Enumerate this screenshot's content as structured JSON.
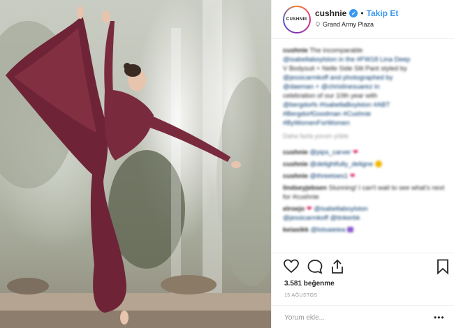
{
  "post": {
    "image_alt": "Dancer in burgundy satin dress posing in front of fountain"
  },
  "header": {
    "avatar_text": "CUSHNIE",
    "username": "cushnie",
    "separator": "•",
    "follow_label": "Takip Et",
    "location": "Grand Army Plaza"
  },
  "caption": {
    "user": "cushnie",
    "lines": [
      "The incomparable",
      "@isabellaboylston in the #FW18 Lina Deep",
      "V Bodysuit + Nelle Side Slit Pant styled by",
      "@jessicarmkoff and photographed by",
      "@daeman + @christinesuarez in",
      "celebration of our 10th year with",
      "@bergdorfs #IsabellaBoylston #ABT",
      "#BergdorfGoodman #Cushnie",
      "#ByWomenForWomen"
    ]
  },
  "view_replies": "Daha fazla yorum yükle",
  "comments": [
    {
      "user": "cushnie",
      "text": "@pips_carver",
      "emoji": "heart"
    },
    {
      "user": "cushnie",
      "text": "@delightfully_deligne",
      "emoji": "face"
    },
    {
      "user": "cushnie",
      "text": "@threetoes1",
      "emoji": "heart"
    },
    {
      "user": "lindseyjebsen",
      "text": "Stunning! I can't wait to see what's next for #cushnie",
      "emoji": ""
    },
    {
      "user": "elroejo",
      "text": "@isabellaboylston",
      "emoji": "heart",
      "extra": "@jessicarmkoff @tinkerbk"
    },
    {
      "user": "keiasikk",
      "text": "@lotsaieiea",
      "emoji": "purple"
    }
  ],
  "actions": {
    "like_icon": "heart-outline-icon",
    "comment_icon": "speech-bubble-icon",
    "share_icon": "share-icon",
    "save_icon": "bookmark-icon"
  },
  "likes": "3.581 beğenme",
  "date": "15 AĞUSTOS",
  "comment_input": {
    "placeholder": "Yorum ekle..."
  },
  "more_label": "•••",
  "colors": {
    "accent": "#3897f0",
    "dress": "#6e2436",
    "heart": "#e0245e"
  }
}
